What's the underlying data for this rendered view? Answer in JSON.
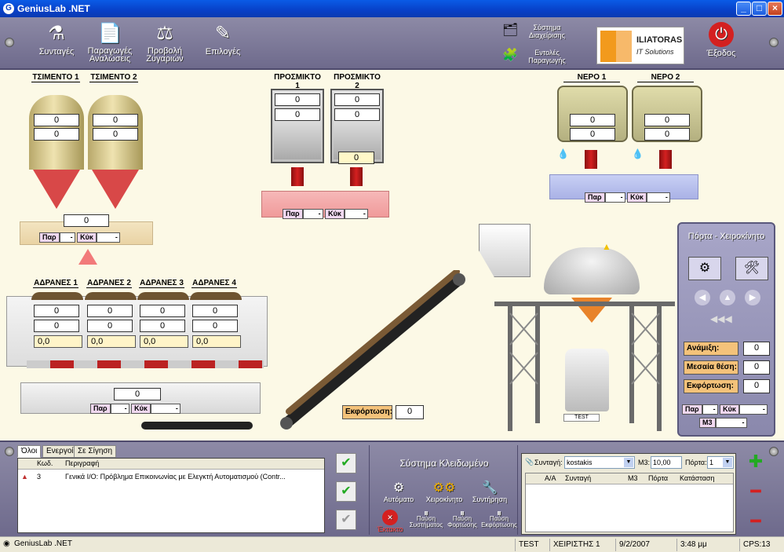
{
  "window": {
    "title": "GeniusLab .NET"
  },
  "toolbar": {
    "recipes": "Συνταγές",
    "production_orders": "Παραγωγές Αναλώσεις",
    "scale_view": "Προβολή Ζυγαριών",
    "options": "Επιλογές",
    "management_system": "Σύστημα Διαχείρισης",
    "production_commands": "Εντολές Παραγωγής",
    "exit": "Έξοδος",
    "logo_name": "ILIATORAS",
    "logo_sub": "IT Solutions"
  },
  "plant": {
    "cement": [
      {
        "label": "ΤΣΙΜΕΝΤΟ 1",
        "v1": "0",
        "v2": "0"
      },
      {
        "label": "ΤΣΙΜΕΝΤΟ 2",
        "v1": "0",
        "v2": "0"
      }
    ],
    "cement_scale": "0",
    "additives": [
      {
        "label": "ΠΡΟΣΜΙΚΤΟ 1",
        "v1": "0",
        "v2": "0"
      },
      {
        "label": "ΠΡΟΣΜΙΚΤΟ 2",
        "v1": "0",
        "v2": "0",
        "v3": "0"
      }
    ],
    "water": [
      {
        "label": "ΝΕΡΟ 1",
        "v1": "0",
        "v2": "0"
      },
      {
        "label": "ΝΕΡΟ 2",
        "v1": "0",
        "v2": "0"
      }
    ],
    "aggregates": [
      {
        "label": "ΑΔΡΑΝΕΣ 1",
        "v1": "0",
        "v2": "0",
        "spin": "0,0"
      },
      {
        "label": "ΑΔΡΑΝΕΣ 2",
        "v1": "0",
        "v2": "0",
        "spin": "0,0"
      },
      {
        "label": "ΑΔΡΑΝΕΣ 3",
        "v1": "0",
        "v2": "0",
        "spin": "0,0"
      },
      {
        "label": "ΑΔΡΑΝΕΣ 4",
        "v1": "0",
        "v2": "0",
        "spin": "0,0"
      }
    ],
    "agg_scale": "0",
    "par": "Παρ",
    "kuk": "Κύκ",
    "dash": "-",
    "unload_label": "Εκφόρτωση:",
    "unload_value": "0",
    "truck_label": "TEST"
  },
  "door_panel": {
    "title": "Πόρτα - Χειροκίνητο",
    "mix": "Ανάμιξη:",
    "mid": "Μεσαία θέση:",
    "unload": "Εκφόρτωση:",
    "mix_v": "0",
    "mid_v": "0",
    "unload_v": "0",
    "par": "Παρ",
    "kuk": "Κύκ",
    "m3": "M3",
    "dash": "-"
  },
  "alarms": {
    "tabs": [
      "Όλοι",
      "Ενεργοί",
      "Σε Σίγηση"
    ],
    "columns": [
      "Κωδ.",
      "Περιγραφή"
    ],
    "rows": [
      {
        "code": "3",
        "desc": "Γενικά Ι/Ο: Πρόβλημα Επικοινωνίας με Ελεγκτή Αυτοματισμού (Contr..."
      }
    ]
  },
  "system": {
    "title": "Σύστημα Κλειδωμένο",
    "auto": "Αυτόματο",
    "manual": "Χειροκίνητο",
    "maint": "Συντήρηση",
    "emergency": "Έκτακτο",
    "pause_sys": "Παύση Συστήματος",
    "pause_load": "Παύση Φορτώσης",
    "pause_unload": "Παύση Εκφόρτωσης"
  },
  "orders": {
    "recipe_label": "Συνταγή:",
    "recipe_value": "kostakis",
    "m3_label": "M3:",
    "m3_value": "10,00",
    "door_label": "Πόρτα:",
    "door_value": "1",
    "columns": [
      "Α/Α",
      "Συνταγή",
      "M3",
      "Πόρτα",
      "Κατάσταση"
    ]
  },
  "status": {
    "app": "GeniusLab .NET",
    "station": "TEST",
    "operator": "ΧΕΙΡΙΣΤΗΣ 1",
    "date": "9/2/2007",
    "time": "3:48 μμ",
    "caps": "CPS:13"
  }
}
